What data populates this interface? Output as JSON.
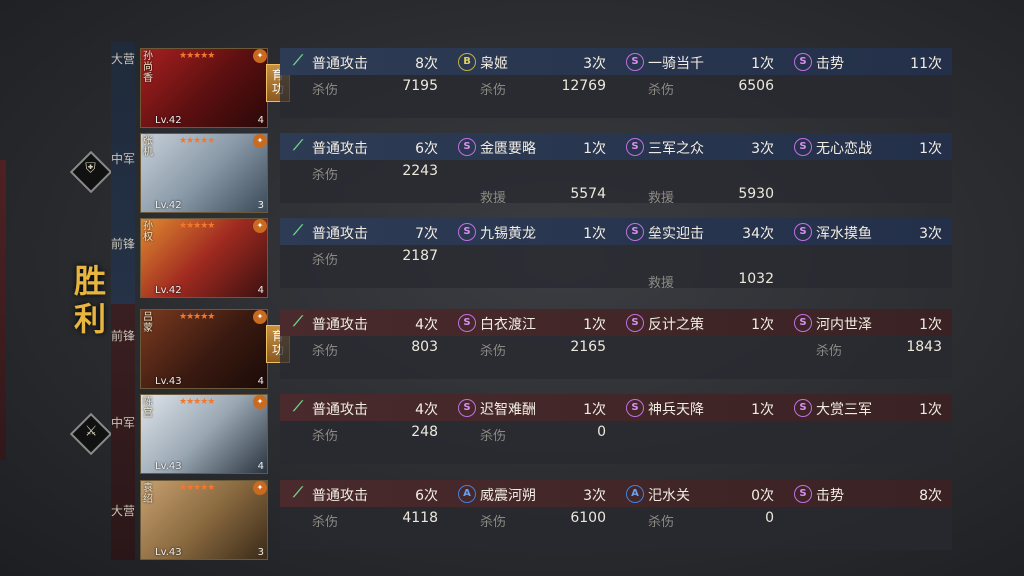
{
  "result": "胜利",
  "ally_icon": "shield-icon",
  "enemy_icon": "blade-icon",
  "ally_positions": [
    "大营",
    "中军",
    "前锋"
  ],
  "enemy_positions": [
    "前锋",
    "中军",
    "大营"
  ],
  "heroes": [
    {
      "name": "孙尚香",
      "level": "Lv.42",
      "num": "4",
      "stars": "★★★★★",
      "badge": "育功",
      "skills": [
        {
          "icon": "sword",
          "name": "普通攻击",
          "times": "8次",
          "label1": "杀伤",
          "value1": "7195"
        },
        {
          "icon": "B",
          "name": "枭姬",
          "times": "3次",
          "label1": "杀伤",
          "value1": "12769"
        },
        {
          "icon": "S",
          "name": "一骑当千",
          "times": "1次",
          "label1": "杀伤",
          "value1": "6506"
        },
        {
          "icon": "S",
          "name": "击势",
          "times": "11次"
        }
      ]
    },
    {
      "name": "张机",
      "level": "Lv.42",
      "num": "3",
      "stars": "★★★★★",
      "skills": [
        {
          "icon": "sword",
          "name": "普通攻击",
          "times": "6次",
          "label1": "杀伤",
          "value1": "2243"
        },
        {
          "icon": "S",
          "name": "金匮要略",
          "times": "1次",
          "label2": "救援",
          "value2": "5574"
        },
        {
          "icon": "S",
          "name": "三军之众",
          "times": "3次",
          "label2": "救援",
          "value2": "5930"
        },
        {
          "icon": "S",
          "name": "无心恋战",
          "times": "1次"
        }
      ]
    },
    {
      "name": "孙权",
      "level": "Lv.42",
      "num": "4",
      "stars": "★★★★★",
      "skills": [
        {
          "icon": "sword",
          "name": "普通攻击",
          "times": "7次",
          "label1": "杀伤",
          "value1": "2187"
        },
        {
          "icon": "S",
          "name": "九锡黄龙",
          "times": "1次"
        },
        {
          "icon": "S",
          "name": "垒实迎击",
          "times": "34次",
          "label2": "救援",
          "value2": "1032"
        },
        {
          "icon": "S",
          "name": "浑水摸鱼",
          "times": "3次"
        }
      ]
    },
    {
      "name": "吕蒙",
      "level": "Lv.43",
      "num": "4",
      "stars": "★★★★★",
      "badge": "育功",
      "skills": [
        {
          "icon": "sword",
          "name": "普通攻击",
          "times": "4次",
          "label1": "杀伤",
          "value1": "803"
        },
        {
          "icon": "S",
          "name": "白衣渡江",
          "times": "1次",
          "label1": "杀伤",
          "value1": "2165"
        },
        {
          "icon": "S",
          "name": "反计之策",
          "times": "1次"
        },
        {
          "icon": "S",
          "name": "河内世泽",
          "times": "1次",
          "label1": "杀伤",
          "value1": "1843"
        }
      ]
    },
    {
      "name": "陈宫",
      "level": "Lv.43",
      "num": "4",
      "stars": "★★★★★",
      "skills": [
        {
          "icon": "sword",
          "name": "普通攻击",
          "times": "4次",
          "label1": "杀伤",
          "value1": "248"
        },
        {
          "icon": "S",
          "name": "迟智难酬",
          "times": "1次",
          "label1": "杀伤",
          "value1": "0"
        },
        {
          "icon": "S",
          "name": "神兵天降",
          "times": "1次"
        },
        {
          "icon": "S",
          "name": "大赏三军",
          "times": "1次"
        }
      ]
    },
    {
      "name": "袁绍",
      "level": "Lv.43",
      "num": "3",
      "stars": "★★★★★",
      "skills": [
        {
          "icon": "sword",
          "name": "普通攻击",
          "times": "6次",
          "label1": "杀伤",
          "value1": "4118"
        },
        {
          "icon": "A",
          "name": "威震河朔",
          "times": "3次",
          "label1": "杀伤",
          "value1": "6100"
        },
        {
          "icon": "A",
          "name": "汜水关",
          "times": "0次",
          "label1": "杀伤",
          "value1": "0"
        },
        {
          "icon": "S",
          "name": "击势",
          "times": "8次"
        }
      ]
    }
  ]
}
